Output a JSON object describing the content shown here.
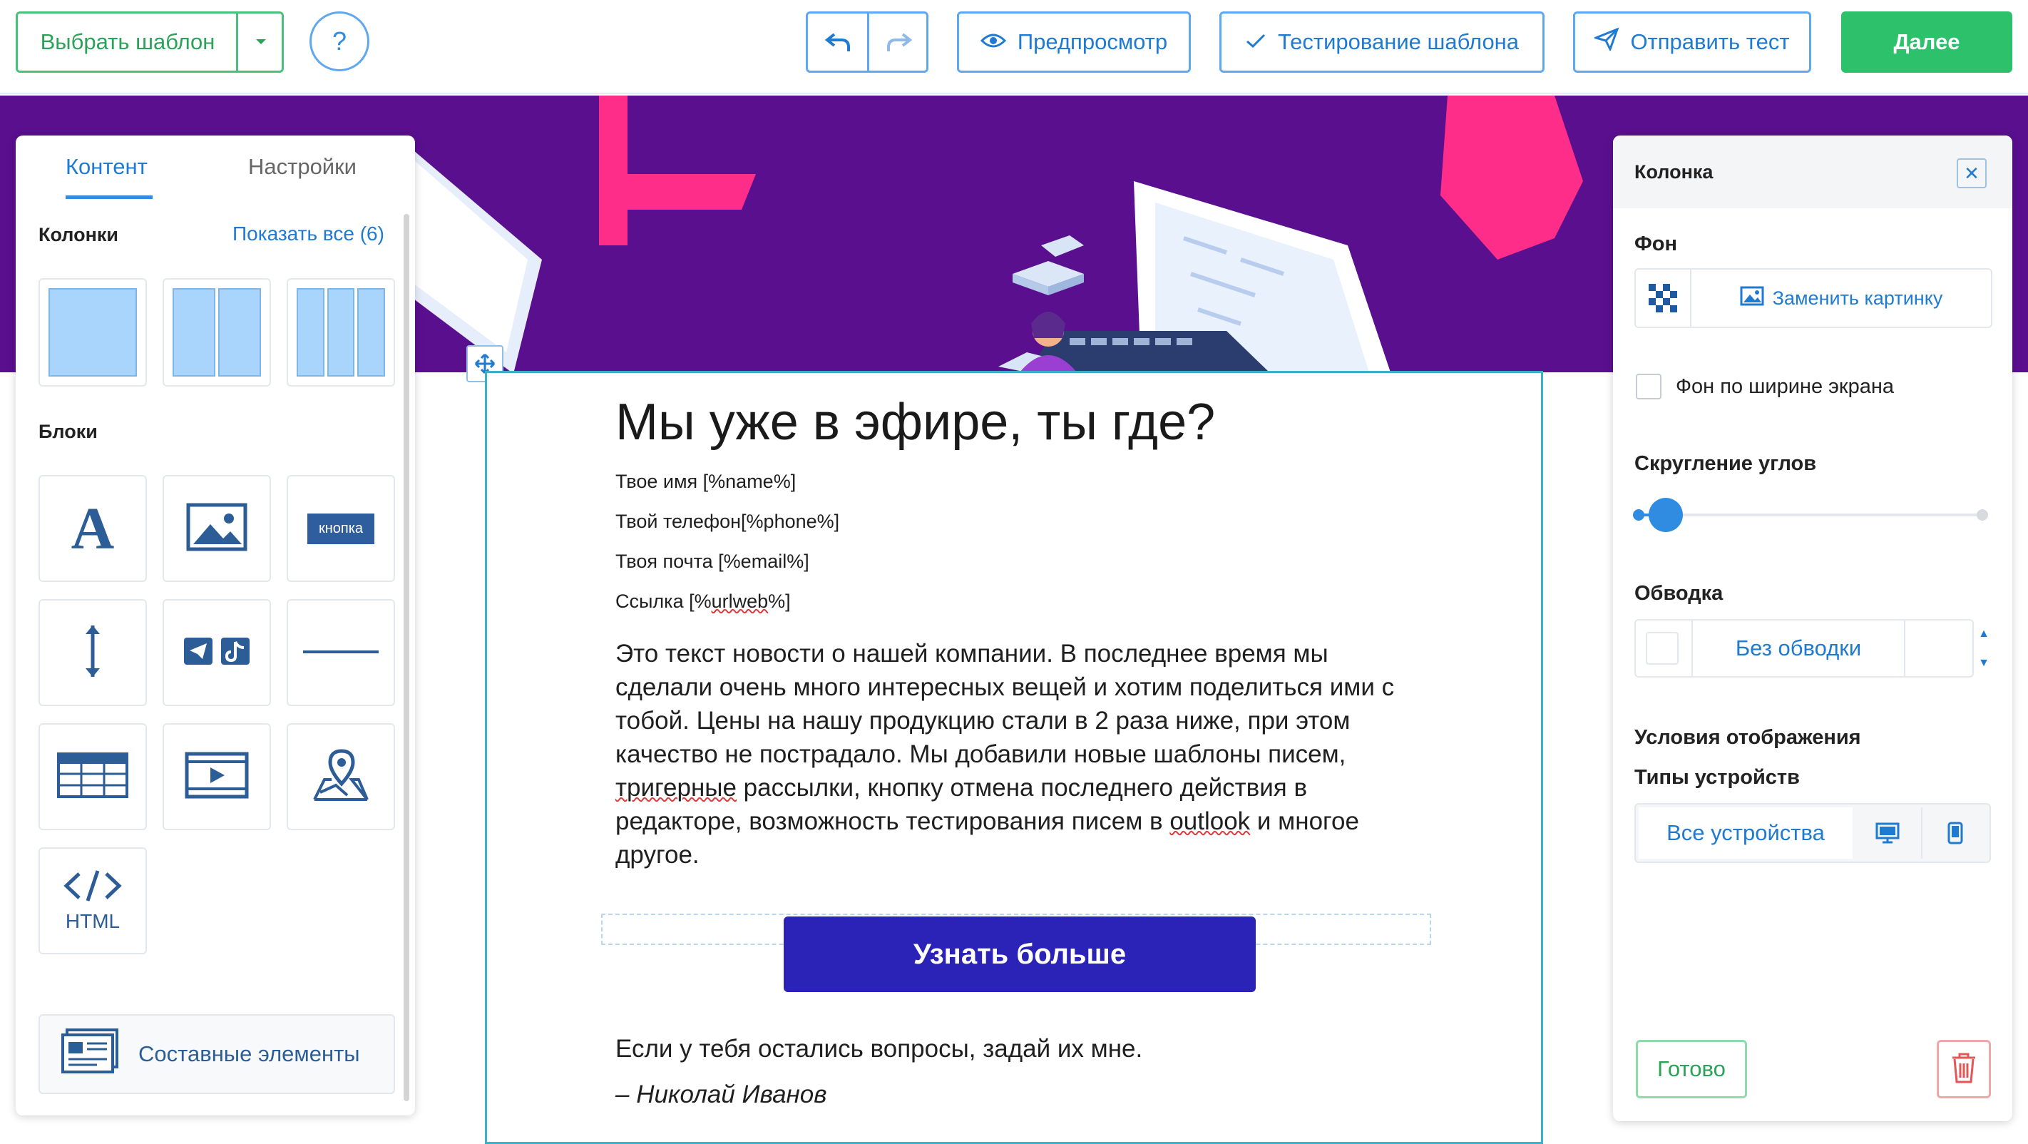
{
  "toolbar": {
    "choose_template": "Выбрать шаблон",
    "help": "?",
    "preview": "Предпросмотр",
    "test_template": "Тестирование шаблона",
    "send_test": "Отправить тест",
    "next": "Далее"
  },
  "left_panel": {
    "tabs": [
      "Контент",
      "Настройки"
    ],
    "active_tab": "Контент",
    "columns_title": "Колонки",
    "show_all": "Показать все (6)",
    "column_presets": [
      1,
      2,
      3
    ],
    "blocks_title": "Блоки",
    "blocks": [
      {
        "name": "text",
        "icon": "text-icon",
        "label": "A"
      },
      {
        "name": "image",
        "icon": "image-icon"
      },
      {
        "name": "button",
        "icon": "button-icon",
        "label": "кнопка"
      },
      {
        "name": "spacer",
        "icon": "spacer-icon"
      },
      {
        "name": "social",
        "icon": "social-icon"
      },
      {
        "name": "divider",
        "icon": "divider-icon"
      },
      {
        "name": "table",
        "icon": "table-icon"
      },
      {
        "name": "video",
        "icon": "video-icon"
      },
      {
        "name": "map",
        "icon": "map-icon"
      },
      {
        "name": "html",
        "icon": "code-icon",
        "label": "HTML"
      }
    ],
    "composite": "Составные элементы"
  },
  "email": {
    "title": "Мы уже в эфире, ты где?",
    "fields": [
      "Твое имя [%name%]",
      "Твой телефон[%phone%]",
      "Твоя почта [%email%]",
      "Ссылка [%urlweb%]"
    ],
    "body_parts": [
      "Это текст новости о нашей компании. В последнее время мы сделали очень много интересных вещей и хотим поделиться ими с тобой. Цены на нашу продукцию стали в 2 раза ниже, при этом качество не пострадало. Мы добавили новые шаблоны писем, ",
      "тригерные",
      " рассылки, кнопку отмена последнего действия в редакторе, возможность тестирования писем в ",
      "outlook",
      " и многое другое."
    ],
    "cta": "Узнать больше",
    "closing": "Если у тебя остались вопросы, задай их мне.",
    "signature": "– Николай Иванов"
  },
  "right_panel": {
    "title": "Колонка",
    "bg_label": "Фон",
    "replace_image": "Заменить картинку",
    "fullwidth_label": "Фон по ширине экрана",
    "fullwidth_checked": false,
    "radius_label": "Скругление углов",
    "radius_value": 0,
    "border_label": "Обводка",
    "border_value": "Без обводки",
    "display_label": "Условия отображения",
    "devices_label": "Типы устройств",
    "device_all": "Все устройства",
    "done": "Готово"
  },
  "colors": {
    "accent_blue": "#1f7ad1",
    "green": "#2ec16b",
    "banner_purple": "#5a0f8f",
    "cta_blue": "#2b22b8",
    "pink": "#ff2d8a"
  }
}
